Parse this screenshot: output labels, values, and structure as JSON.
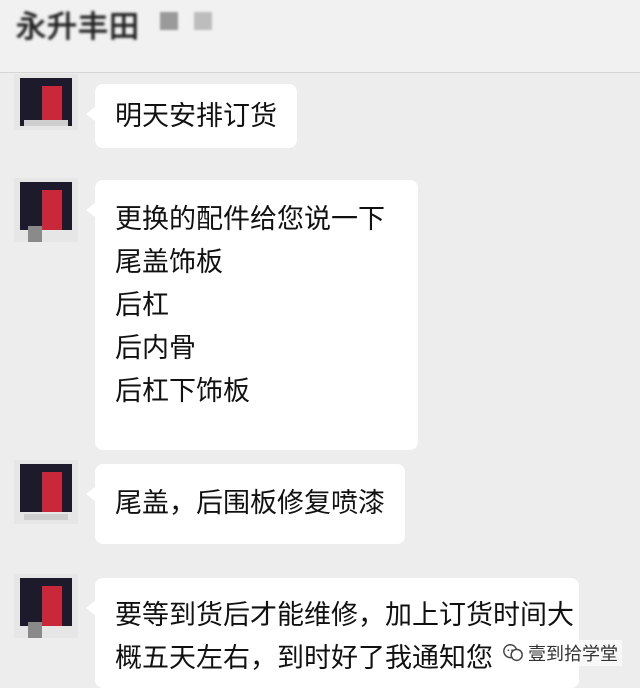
{
  "header": {
    "title": "永升丰田"
  },
  "messages": [
    {
      "lines": [
        "明天安排订货"
      ]
    },
    {
      "lines": [
        "更换的配件给您说一下",
        "尾盖饰板",
        "后杠",
        "后内骨",
        "后杠下饰板"
      ]
    },
    {
      "lines": [
        "尾盖，后围板修复喷漆"
      ]
    },
    {
      "lines": [
        "要等到货后才能维修，加上订货时间大",
        "概五天左右，到时好了我通知您"
      ]
    }
  ],
  "watermark": {
    "text": "壹到拾学堂",
    "icon": "wechat-official-account-icon"
  },
  "colors": {
    "background": "#ededed",
    "bubble": "#ffffff",
    "avatar_accent": "#c8283a"
  }
}
